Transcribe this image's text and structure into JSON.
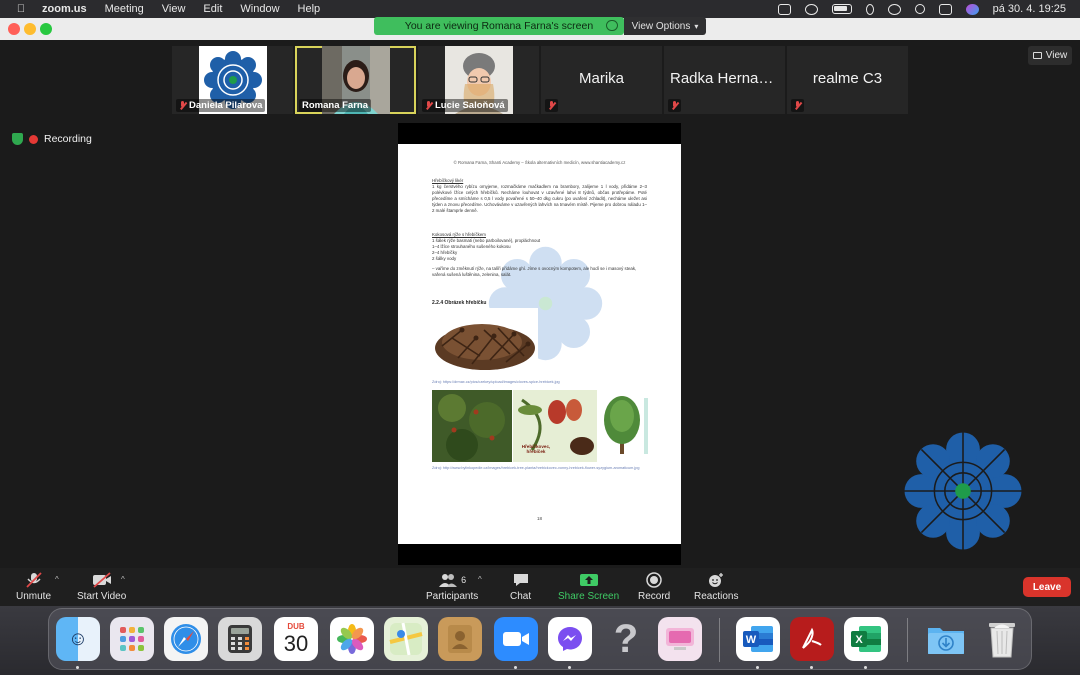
{
  "menubar": {
    "app": "zoom.us",
    "items": [
      "Meeting",
      "View",
      "Edit",
      "Window",
      "Help"
    ],
    "clock": "pá 30. 4.  19:25"
  },
  "banner": {
    "text": "You are viewing Romana Farna's screen",
    "view_options": "View Options"
  },
  "participants_strip": [
    {
      "name": "Daniela Pilarova",
      "type": "logo",
      "muted": true
    },
    {
      "name": "Romana Farna",
      "type": "photo",
      "active": true,
      "muted": false
    },
    {
      "name": "Lucie Saloňová",
      "type": "photo",
      "muted": true
    },
    {
      "name": "Marika",
      "type": "name-only",
      "muted": true
    },
    {
      "name": "Radka Hernan...",
      "type": "name-only",
      "muted": true
    },
    {
      "name": "realme C3",
      "type": "name-only",
      "muted": true
    }
  ],
  "view_button": "View",
  "recording_label": "Recording",
  "document": {
    "header": "© Romana Farna, Shanti Academy – Škola alternativních medicín, www.shantiacademy.cz",
    "section1_title": "Hřebíčkový likér",
    "section1_text": "1 kg čerstvého rybízu omyjeme, rozmačkáme mačkadlem na brambory, zalijeme 1 l vody, přidáme 2–3 polévkové lžíce celých hřebíčků. Necháme louhovat v uzavřené lahvi 8 týdnů, občas protřepáme. Poté přecedíme a smícháme s 0,5 l vody povařené s 50–40 dkg cukru (po uvaření zchladit), necháme uležet asi týden a znovu přecedíme. Uchováváme v uzavřených lahvích na tmavém místě. Pijeme pro dobrou náladu 1–2 malé štamprle denně.",
    "section2_title": "Kokosová rýže s hřebíčkem",
    "section2_lines": [
      "1 šálek rýže basmati (nebo parboilované), propláchnout",
      "1–4 lžíce strouhaného sušeného kokosu",
      "2–4 hřebíčky",
      "2 šálky vody"
    ],
    "section2_note": "– vaříme do změknutí rýže, na talíři přidáme ghí. Jíme s ovocným kompotem, ale hodí se i masový steak, vařená sušená luštěnina, zelenina, salát.",
    "section3_title": "2.2.4 Obrázek hřebíčku",
    "caption1": "Zdroj: https://drmax.cz/pics/czekey/upload/images/cloves-spice-hrebicek.jpg",
    "image_label": "Hřebíčkovec, hřebíček",
    "caption2": "Zdroj: http://www.bylinkopedie.cz/images/hrebicek-tree-planta/hrebickovec-vonny-hrebicek-flower-syzygium-aromaticum.jpg",
    "page_number": "18"
  },
  "toolbar": {
    "unmute": "Unmute",
    "start_video": "Start Video",
    "participants": "Participants",
    "participants_count": "6",
    "chat": "Chat",
    "share_screen": "Share Screen",
    "record": "Record",
    "reactions": "Reactions",
    "leave": "Leave"
  },
  "dock": {
    "calendar_month": "DUB",
    "calendar_day": "30",
    "apps": [
      "Finder",
      "Launchpad",
      "Safari",
      "Calculator",
      "Calendar",
      "Photos",
      "Maps",
      "Contacts",
      "Zoom",
      "Messenger",
      "Help",
      "CleanMyMac",
      "Word",
      "Acrobat",
      "Excel",
      "Downloads",
      "Trash"
    ]
  },
  "colors": {
    "accent_green": "#3fbe5d",
    "leave_red": "#d9342b",
    "logo_blue": "#1f5fa8"
  }
}
